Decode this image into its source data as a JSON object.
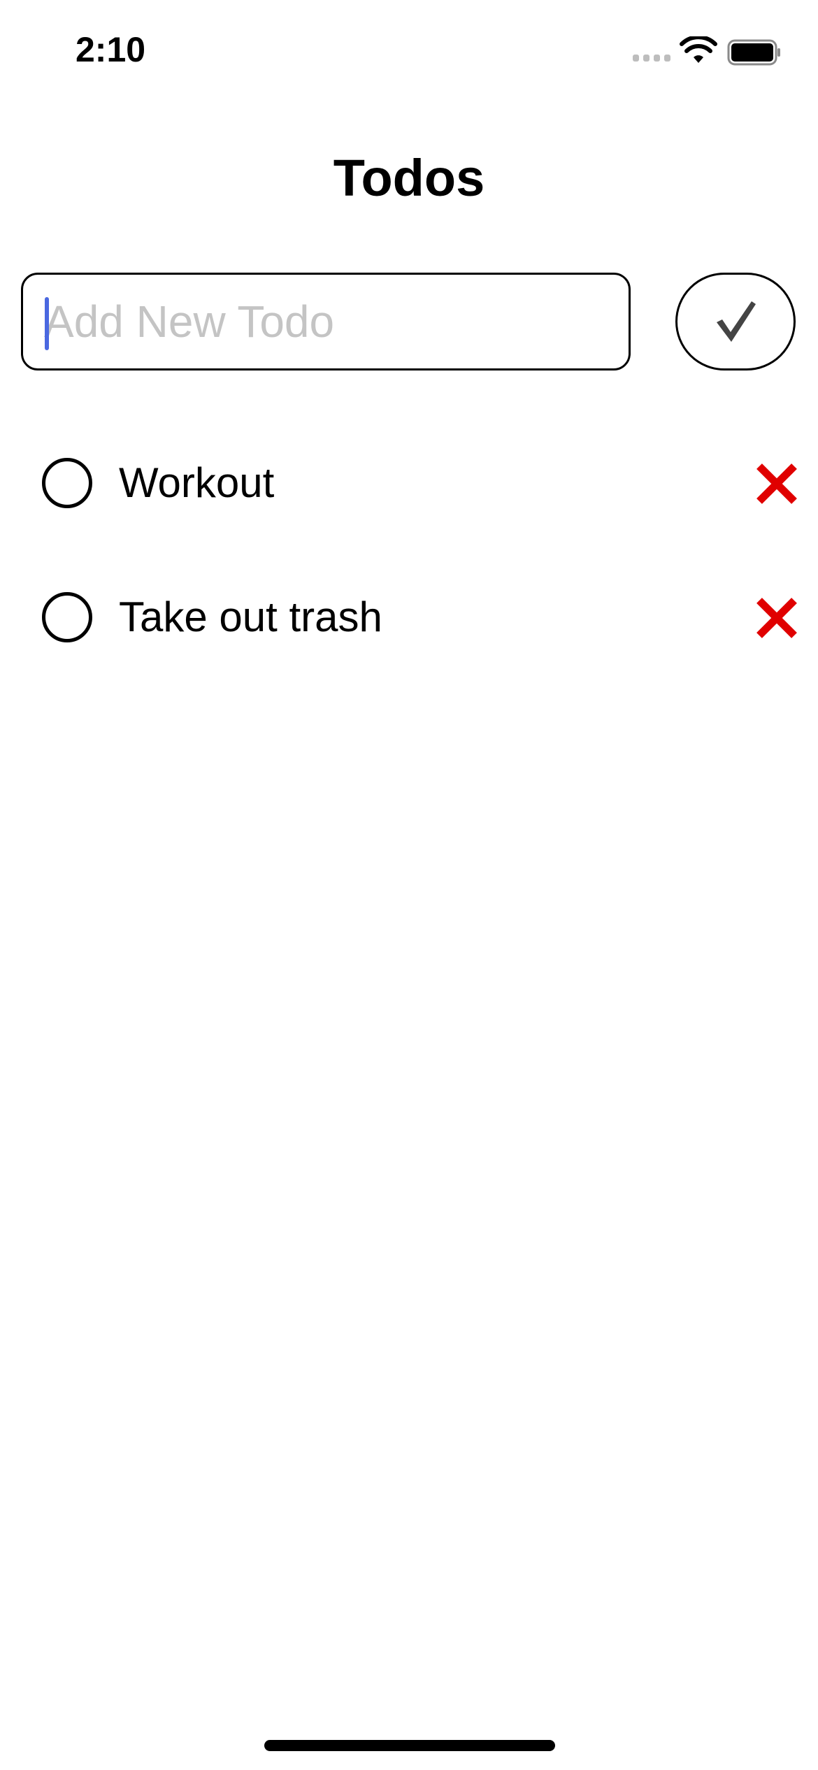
{
  "status_bar": {
    "time": "2:10",
    "signal_icon": "cellular-signal-icon",
    "wifi_icon": "wifi-icon",
    "battery_icon": "battery-icon"
  },
  "header": {
    "title": "Todos"
  },
  "new_todo": {
    "placeholder": "Add New Todo",
    "value": "",
    "submit_icon": "checkmark-icon"
  },
  "todos": [
    {
      "label": "Workout",
      "completed": false,
      "delete_icon": "close-x-icon"
    },
    {
      "label": "Take out trash",
      "completed": false,
      "delete_icon": "close-x-icon"
    }
  ],
  "colors": {
    "delete": "#e00000",
    "caret": "#4a68e0",
    "placeholder": "#c4c4c4",
    "check": "#444444"
  }
}
